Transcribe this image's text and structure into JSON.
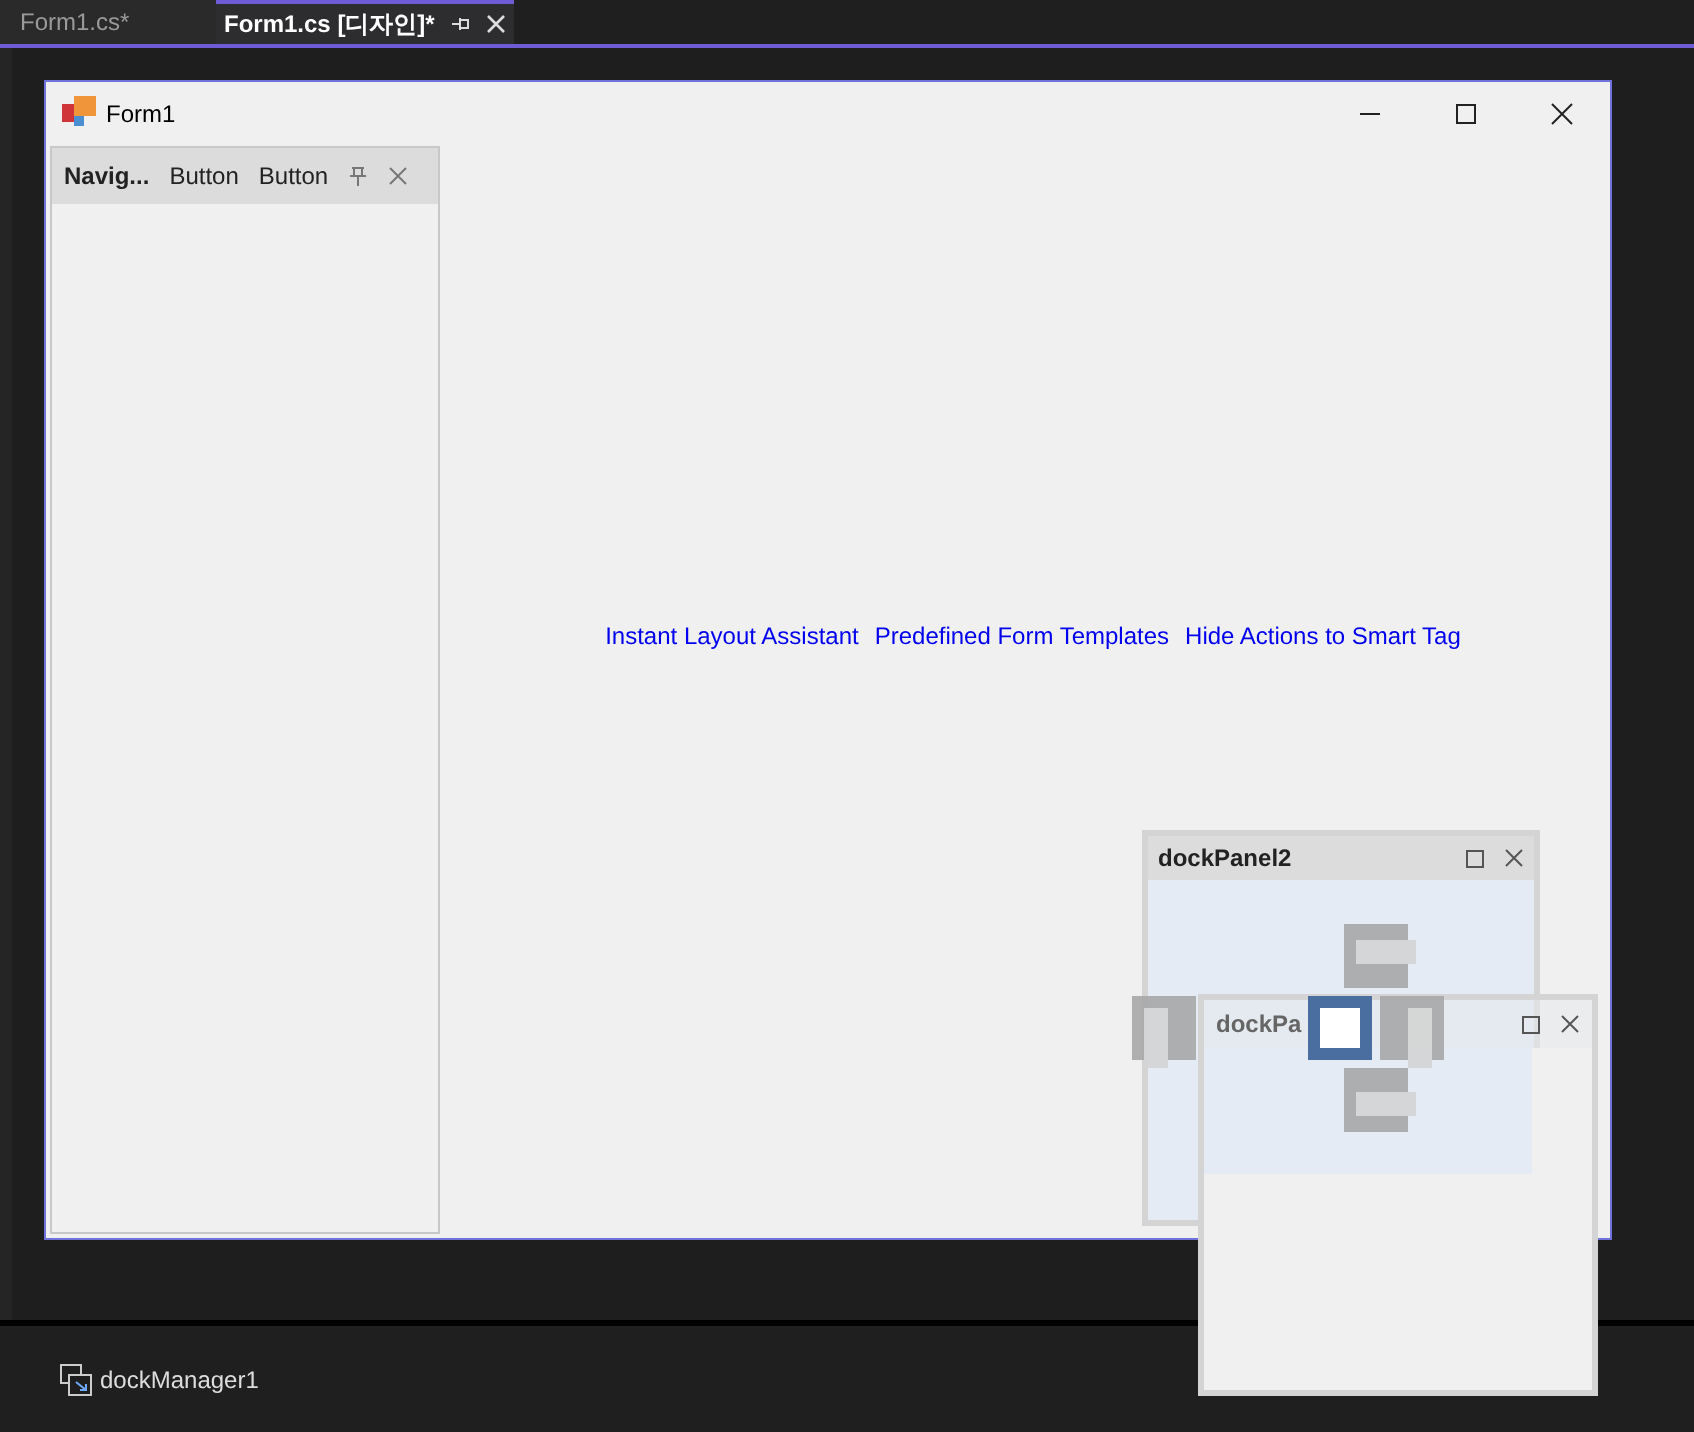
{
  "tabs": [
    {
      "label": "Form1.cs*",
      "selected": false
    },
    {
      "label": "Form1.cs [디자인]*",
      "selected": true
    }
  ],
  "form": {
    "title": "Form1",
    "nav_panel": {
      "title": "Navig...",
      "buttons": [
        "Button",
        "Button"
      ]
    },
    "links": [
      "Instant Layout Assistant",
      "Predefined Form Templates",
      "Hide Actions to Smart Tag"
    ]
  },
  "floating_panels": [
    {
      "title": "dockPanel2"
    },
    {
      "title": "dockPa"
    }
  ],
  "component_tray": {
    "items": [
      "dockManager1"
    ]
  }
}
